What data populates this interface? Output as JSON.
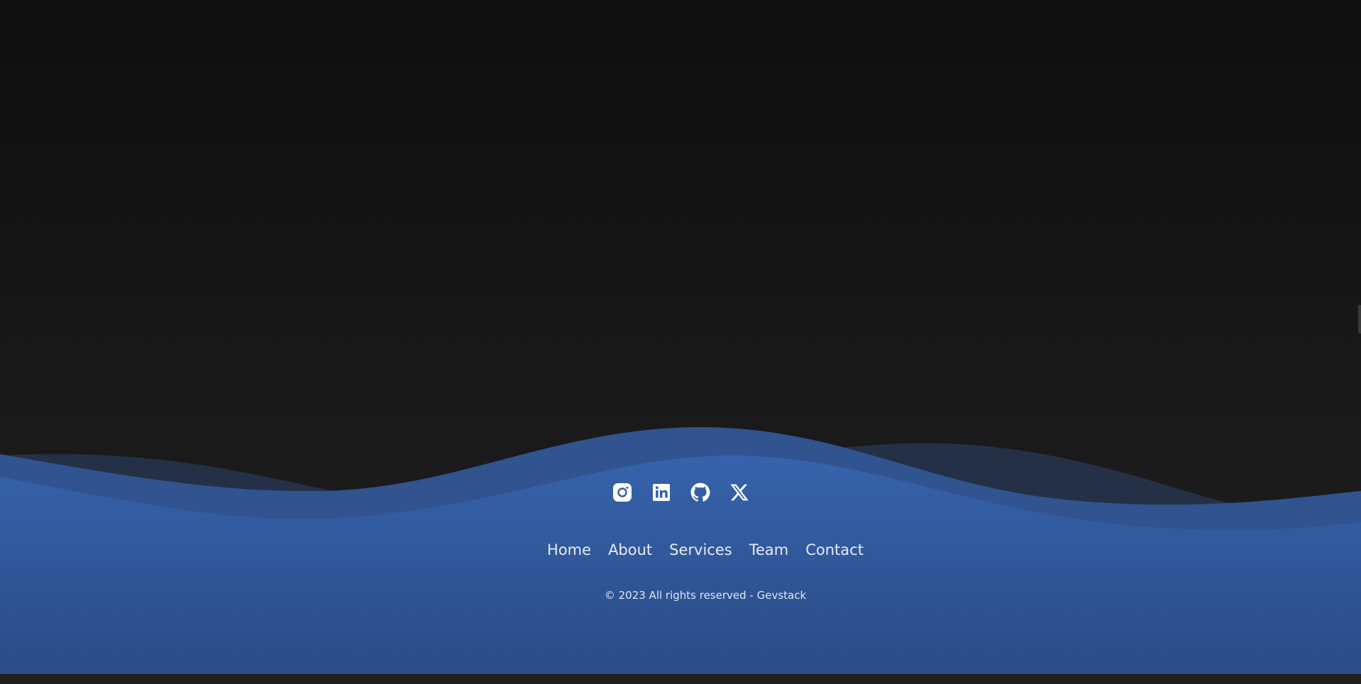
{
  "colors": {
    "page_background": "#141414",
    "footer_blue": "#325fa6",
    "footer_blue_dark": "#2c4c8a",
    "wave_back": "#2a3652",
    "wave_mid": "#31528c",
    "text_light": "#e6ebf5"
  },
  "socials": [
    {
      "icon": "instagram-icon",
      "label": "Instagram"
    },
    {
      "icon": "linkedin-icon",
      "label": "LinkedIn"
    },
    {
      "icon": "github-icon",
      "label": "GitHub"
    },
    {
      "icon": "x-icon",
      "label": "X"
    }
  ],
  "nav": {
    "home": "Home",
    "about": "About",
    "services": "Services",
    "team": "Team",
    "contact": "Contact"
  },
  "copyright": "© 2023 All rights reserved - Gevstack"
}
